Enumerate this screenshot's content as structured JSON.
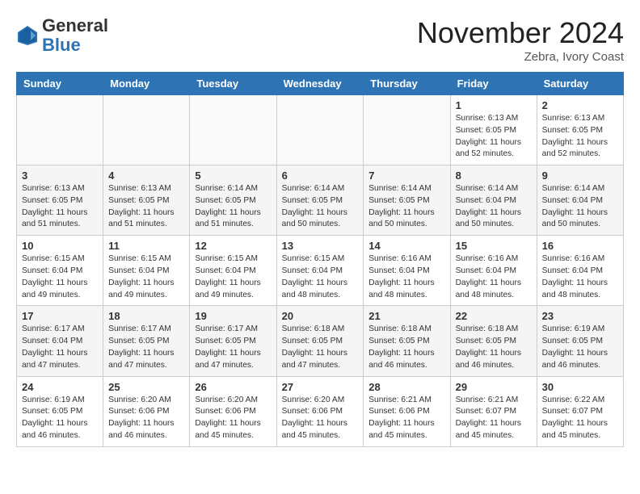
{
  "header": {
    "logo_general": "General",
    "logo_blue": "Blue",
    "month_title": "November 2024",
    "location": "Zebra, Ivory Coast"
  },
  "days_of_week": [
    "Sunday",
    "Monday",
    "Tuesday",
    "Wednesday",
    "Thursday",
    "Friday",
    "Saturday"
  ],
  "weeks": [
    [
      {
        "day": "",
        "info": ""
      },
      {
        "day": "",
        "info": ""
      },
      {
        "day": "",
        "info": ""
      },
      {
        "day": "",
        "info": ""
      },
      {
        "day": "",
        "info": ""
      },
      {
        "day": "1",
        "info": "Sunrise: 6:13 AM\nSunset: 6:05 PM\nDaylight: 11 hours and 52 minutes."
      },
      {
        "day": "2",
        "info": "Sunrise: 6:13 AM\nSunset: 6:05 PM\nDaylight: 11 hours and 52 minutes."
      }
    ],
    [
      {
        "day": "3",
        "info": "Sunrise: 6:13 AM\nSunset: 6:05 PM\nDaylight: 11 hours and 51 minutes."
      },
      {
        "day": "4",
        "info": "Sunrise: 6:13 AM\nSunset: 6:05 PM\nDaylight: 11 hours and 51 minutes."
      },
      {
        "day": "5",
        "info": "Sunrise: 6:14 AM\nSunset: 6:05 PM\nDaylight: 11 hours and 51 minutes."
      },
      {
        "day": "6",
        "info": "Sunrise: 6:14 AM\nSunset: 6:05 PM\nDaylight: 11 hours and 50 minutes."
      },
      {
        "day": "7",
        "info": "Sunrise: 6:14 AM\nSunset: 6:05 PM\nDaylight: 11 hours and 50 minutes."
      },
      {
        "day": "8",
        "info": "Sunrise: 6:14 AM\nSunset: 6:04 PM\nDaylight: 11 hours and 50 minutes."
      },
      {
        "day": "9",
        "info": "Sunrise: 6:14 AM\nSunset: 6:04 PM\nDaylight: 11 hours and 50 minutes."
      }
    ],
    [
      {
        "day": "10",
        "info": "Sunrise: 6:15 AM\nSunset: 6:04 PM\nDaylight: 11 hours and 49 minutes."
      },
      {
        "day": "11",
        "info": "Sunrise: 6:15 AM\nSunset: 6:04 PM\nDaylight: 11 hours and 49 minutes."
      },
      {
        "day": "12",
        "info": "Sunrise: 6:15 AM\nSunset: 6:04 PM\nDaylight: 11 hours and 49 minutes."
      },
      {
        "day": "13",
        "info": "Sunrise: 6:15 AM\nSunset: 6:04 PM\nDaylight: 11 hours and 48 minutes."
      },
      {
        "day": "14",
        "info": "Sunrise: 6:16 AM\nSunset: 6:04 PM\nDaylight: 11 hours and 48 minutes."
      },
      {
        "day": "15",
        "info": "Sunrise: 6:16 AM\nSunset: 6:04 PM\nDaylight: 11 hours and 48 minutes."
      },
      {
        "day": "16",
        "info": "Sunrise: 6:16 AM\nSunset: 6:04 PM\nDaylight: 11 hours and 48 minutes."
      }
    ],
    [
      {
        "day": "17",
        "info": "Sunrise: 6:17 AM\nSunset: 6:04 PM\nDaylight: 11 hours and 47 minutes."
      },
      {
        "day": "18",
        "info": "Sunrise: 6:17 AM\nSunset: 6:05 PM\nDaylight: 11 hours and 47 minutes."
      },
      {
        "day": "19",
        "info": "Sunrise: 6:17 AM\nSunset: 6:05 PM\nDaylight: 11 hours and 47 minutes."
      },
      {
        "day": "20",
        "info": "Sunrise: 6:18 AM\nSunset: 6:05 PM\nDaylight: 11 hours and 47 minutes."
      },
      {
        "day": "21",
        "info": "Sunrise: 6:18 AM\nSunset: 6:05 PM\nDaylight: 11 hours and 46 minutes."
      },
      {
        "day": "22",
        "info": "Sunrise: 6:18 AM\nSunset: 6:05 PM\nDaylight: 11 hours and 46 minutes."
      },
      {
        "day": "23",
        "info": "Sunrise: 6:19 AM\nSunset: 6:05 PM\nDaylight: 11 hours and 46 minutes."
      }
    ],
    [
      {
        "day": "24",
        "info": "Sunrise: 6:19 AM\nSunset: 6:05 PM\nDaylight: 11 hours and 46 minutes."
      },
      {
        "day": "25",
        "info": "Sunrise: 6:20 AM\nSunset: 6:06 PM\nDaylight: 11 hours and 46 minutes."
      },
      {
        "day": "26",
        "info": "Sunrise: 6:20 AM\nSunset: 6:06 PM\nDaylight: 11 hours and 45 minutes."
      },
      {
        "day": "27",
        "info": "Sunrise: 6:20 AM\nSunset: 6:06 PM\nDaylight: 11 hours and 45 minutes."
      },
      {
        "day": "28",
        "info": "Sunrise: 6:21 AM\nSunset: 6:06 PM\nDaylight: 11 hours and 45 minutes."
      },
      {
        "day": "29",
        "info": "Sunrise: 6:21 AM\nSunset: 6:07 PM\nDaylight: 11 hours and 45 minutes."
      },
      {
        "day": "30",
        "info": "Sunrise: 6:22 AM\nSunset: 6:07 PM\nDaylight: 11 hours and 45 minutes."
      }
    ]
  ]
}
